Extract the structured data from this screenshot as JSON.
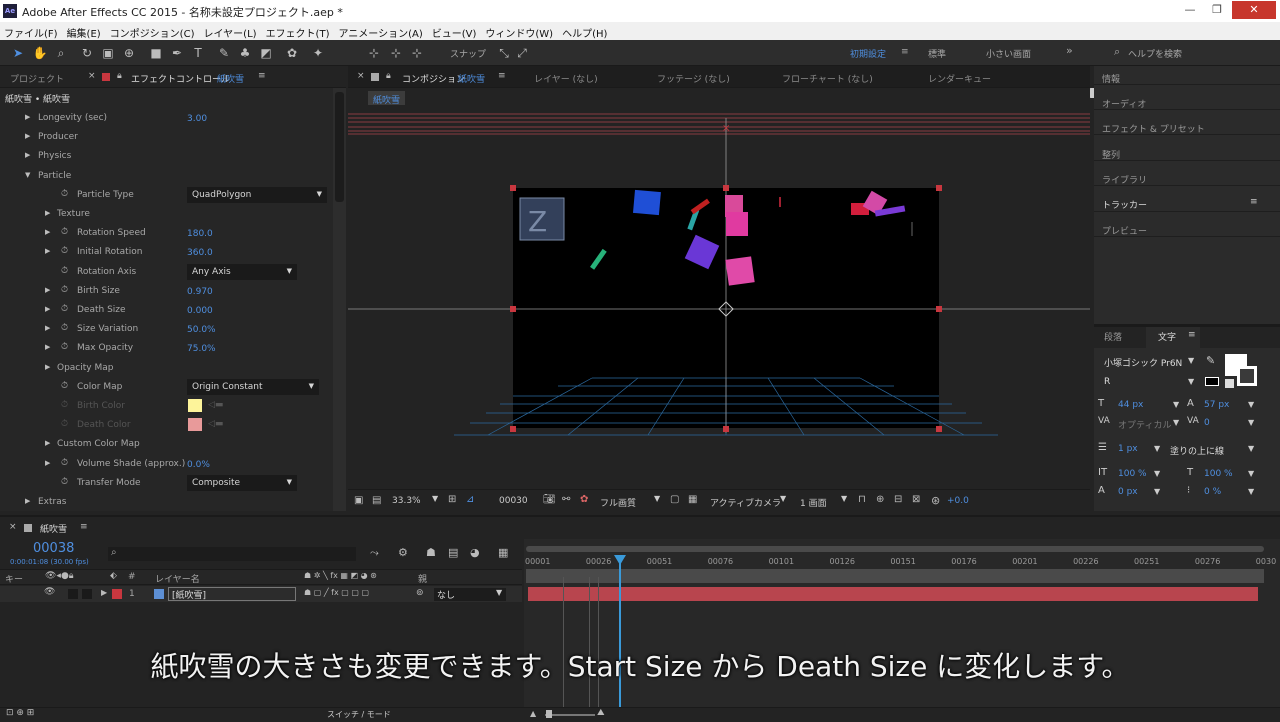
{
  "window": {
    "title": "Adobe After Effects CC 2015 - 名称未設定プロジェクト.aep *",
    "app_icon": "Ae"
  },
  "menu": [
    "ファイル(F)",
    "編集(E)",
    "コンポジション(C)",
    "レイヤー(L)",
    "エフェクト(T)",
    "アニメーション(A)",
    "ビュー(V)",
    "ウィンドウ(W)",
    "ヘルプ(H)"
  ],
  "toolbar": {
    "snap_label": "スナップ",
    "workspace_active": "初期設定",
    "workspace_2": "標準",
    "workspace_3": "小さい画面",
    "search_placeholder": "ヘルプを検索"
  },
  "left_panel": {
    "tab_project": "プロジェクト",
    "tab_effect_controls": "エフェクトコントロール",
    "tab_layer_name": "紙吹雪",
    "breadcrumb": "紙吹雪 • 紙吹雪",
    "properties": [
      {
        "name": "Longevity (sec)",
        "value": "3.00"
      },
      {
        "name": "Producer"
      },
      {
        "name": "Physics"
      },
      {
        "name": "Particle"
      },
      {
        "name": "Particle Type",
        "value": "QuadPolygon"
      },
      {
        "name": "Texture"
      },
      {
        "name": "Rotation Speed",
        "value": "180.0"
      },
      {
        "name": "Initial Rotation",
        "value": "360.0"
      },
      {
        "name": "Rotation Axis",
        "value": "Any Axis"
      },
      {
        "name": "Birth Size",
        "value": "0.970"
      },
      {
        "name": "Death Size",
        "value": "0.000"
      },
      {
        "name": "Size Variation",
        "value": "50.0%"
      },
      {
        "name": "Max Opacity",
        "value": "75.0%"
      },
      {
        "name": "Opacity Map"
      },
      {
        "name": "Color Map",
        "value": "Origin Constant"
      },
      {
        "name": "Birth Color"
      },
      {
        "name": "Death Color"
      },
      {
        "name": "Custom Color Map"
      },
      {
        "name": "Volume Shade (approx.)",
        "value": "0.0%"
      },
      {
        "name": "Transfer Mode",
        "value": "Composite"
      },
      {
        "name": "Extras"
      }
    ],
    "birth_color": "#fdf49a",
    "death_color": "#e89a9a"
  },
  "comp_panel": {
    "tab_composition": "コンポジション",
    "comp_name": "紙吹雪",
    "tab_layer": "レイヤー (なし)",
    "tab_footage": "フッテージ (なし)",
    "tab_flowchart": "フローチャート (なし)",
    "tab_render": "レンダーキュー",
    "comp_chip": "紙吹雪",
    "zoom": "33.3%",
    "timecode": "00030",
    "resolution": "フル画質",
    "camera": "アクティブカメラ",
    "views": "1 画面",
    "exposure": "+0.0"
  },
  "right_panel": {
    "items": [
      "情報",
      "オーディオ",
      "エフェクト & プリセット",
      "整列",
      "ライブラリ",
      "トラッカー",
      "プレビュー"
    ],
    "tab_paragraph": "段落",
    "tab_character": "文字",
    "font_name": "小塚ゴシック Pr6N",
    "font_style": "R",
    "font_size": "44 px",
    "leading": "57 px",
    "kerning": "オプティカル",
    "tracking": "0",
    "stroke_width": "1 px",
    "stroke_mode": "塗りの上に線",
    "vscale": "100 %",
    "hscale": "100 %",
    "baseline": "0 px",
    "tsume": "0 %"
  },
  "timeline": {
    "tab_name": "紙吹雪",
    "current_frame": "00038",
    "timecode_sub": "0:00:01:08 (30.00 fps)",
    "col_key": "キー",
    "col_num": "#",
    "col_layer_name": "レイヤー名",
    "col_parent": "親",
    "layer_num": "1",
    "layer_name": "[紙吹雪]",
    "parent_value": "なし",
    "ruler": [
      "00001",
      "00026",
      "00051",
      "00076",
      "00101",
      "00126",
      "00151",
      "00176",
      "00201",
      "00226",
      "00251",
      "00276",
      "0030"
    ],
    "switch_mode": "スイッチ / モード"
  },
  "subtitle": "紙吹雪の大きさも変更できます。Start Size から Death Size に変化します。",
  "colors": {
    "accent_blue": "#4f8fe0",
    "layer_bar": "#b8454e",
    "playhead": "#3a9ad9",
    "label_red": "#c8373f"
  }
}
